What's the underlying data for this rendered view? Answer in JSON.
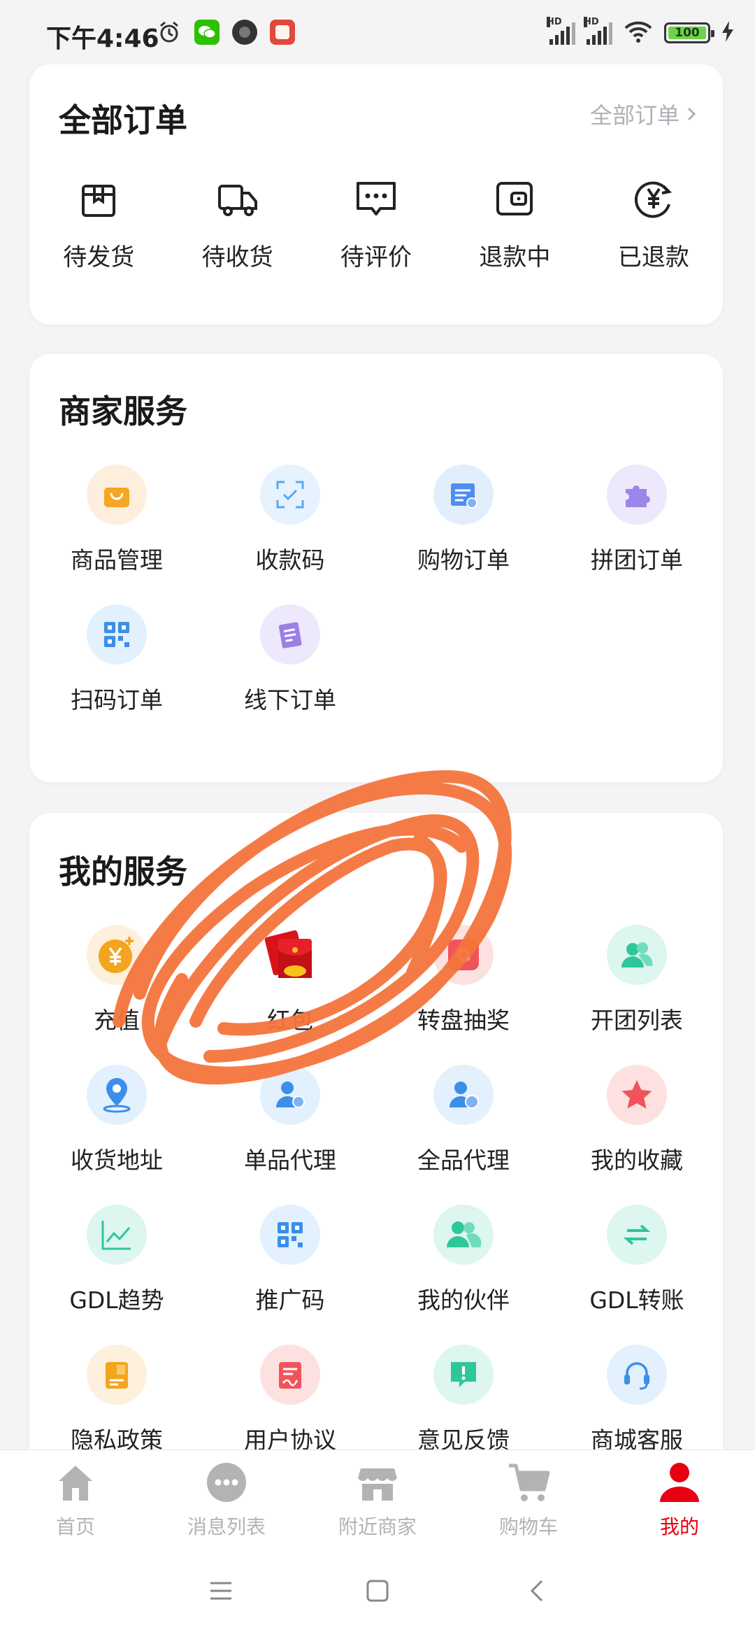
{
  "status": {
    "time": "下午4:46",
    "battery": "100",
    "hd1": "HD",
    "hd2": "HD"
  },
  "orders": {
    "title": "全部订单",
    "link_label": "全部订单",
    "items": [
      {
        "label": "待发货",
        "icon": "package-icon"
      },
      {
        "label": "待收货",
        "icon": "truck-icon"
      },
      {
        "label": "待评价",
        "icon": "comment-icon"
      },
      {
        "label": "退款中",
        "icon": "wallet-icon"
      },
      {
        "label": "已退款",
        "icon": "refund-yen-icon"
      }
    ]
  },
  "merchant": {
    "title": "商家服务",
    "items": [
      {
        "label": "商品管理",
        "icon": "shopping-bag-icon",
        "bg": "#fdeedd",
        "fg": "#f5a623"
      },
      {
        "label": "收款码",
        "icon": "scan-check-icon",
        "bg": "#e6f2fd",
        "fg": "#5aa6ef"
      },
      {
        "label": "购物订单",
        "icon": "order-list-icon",
        "bg": "#e3eefc",
        "fg": "#4d8ef0"
      },
      {
        "label": "拼团订单",
        "icon": "puzzle-icon",
        "bg": "#ede8fb",
        "fg": "#9b86ea"
      },
      {
        "label": "扫码订单",
        "icon": "qr-code-icon",
        "bg": "#e3f0fd",
        "fg": "#3b8fe8"
      },
      {
        "label": "线下订单",
        "icon": "note-icon",
        "bg": "#ede8fb",
        "fg": "#9b7fe6"
      }
    ]
  },
  "services": {
    "title": "我的服务",
    "items": [
      {
        "label": "充值",
        "icon": "yen-coin-icon",
        "bg": "#fdf0dc",
        "fg": "#f3a51e"
      },
      {
        "label": "红包",
        "icon": "red-envelope-icon",
        "bg": "#ffffff",
        "fg": "#d8141a"
      },
      {
        "label": "转盘抽奖",
        "icon": "wheel-icon",
        "bg": "#fde1e1",
        "fg": "#f0545a"
      },
      {
        "label": "开团列表",
        "icon": "group-icon",
        "bg": "#ddf6ef",
        "fg": "#2ec79b"
      },
      {
        "label": "收货地址",
        "icon": "location-icon",
        "bg": "#e3f0fd",
        "fg": "#3b8fe8"
      },
      {
        "label": "单品代理",
        "icon": "agent-icon",
        "bg": "#e3f0fd",
        "fg": "#3b8fe8"
      },
      {
        "label": "全品代理",
        "icon": "agent-dai-icon",
        "bg": "#e3f0fd",
        "fg": "#3b8fe8"
      },
      {
        "label": "我的收藏",
        "icon": "star-icon",
        "bg": "#fde1e1",
        "fg": "#f0545a"
      },
      {
        "label": "GDL趋势",
        "icon": "trend-icon",
        "bg": "#ddf6ef",
        "fg": "#2ec79b"
      },
      {
        "label": "推广码",
        "icon": "qr-code-icon",
        "bg": "#e3f0fd",
        "fg": "#3b8fe8"
      },
      {
        "label": "我的伙伴",
        "icon": "partners-icon",
        "bg": "#ddf6ef",
        "fg": "#2ec79b"
      },
      {
        "label": "GDL转账",
        "icon": "transfer-icon",
        "bg": "#ddf6ef",
        "fg": "#2ec79b"
      },
      {
        "label": "隐私政策",
        "icon": "privacy-doc-icon",
        "bg": "#fdf0dc",
        "fg": "#f3a51e"
      },
      {
        "label": "用户协议",
        "icon": "agreement-icon",
        "bg": "#fde1e1",
        "fg": "#f0545a"
      },
      {
        "label": "意见反馈",
        "icon": "feedback-icon",
        "bg": "#ddf6ef",
        "fg": "#2ec79b"
      },
      {
        "label": "商城客服",
        "icon": "headset-icon",
        "bg": "#e3f0fd",
        "fg": "#3b8fe8"
      }
    ]
  },
  "nav": {
    "items": [
      {
        "label": "首页",
        "icon": "home-icon"
      },
      {
        "label": "消息列表",
        "icon": "message-icon"
      },
      {
        "label": "附近商家",
        "icon": "shop-icon"
      },
      {
        "label": "购物车",
        "icon": "cart-icon"
      },
      {
        "label": "我的",
        "icon": "profile-icon",
        "active": true
      }
    ],
    "active_color": "#e60012"
  },
  "annotation": {
    "color": "#f5743d"
  }
}
